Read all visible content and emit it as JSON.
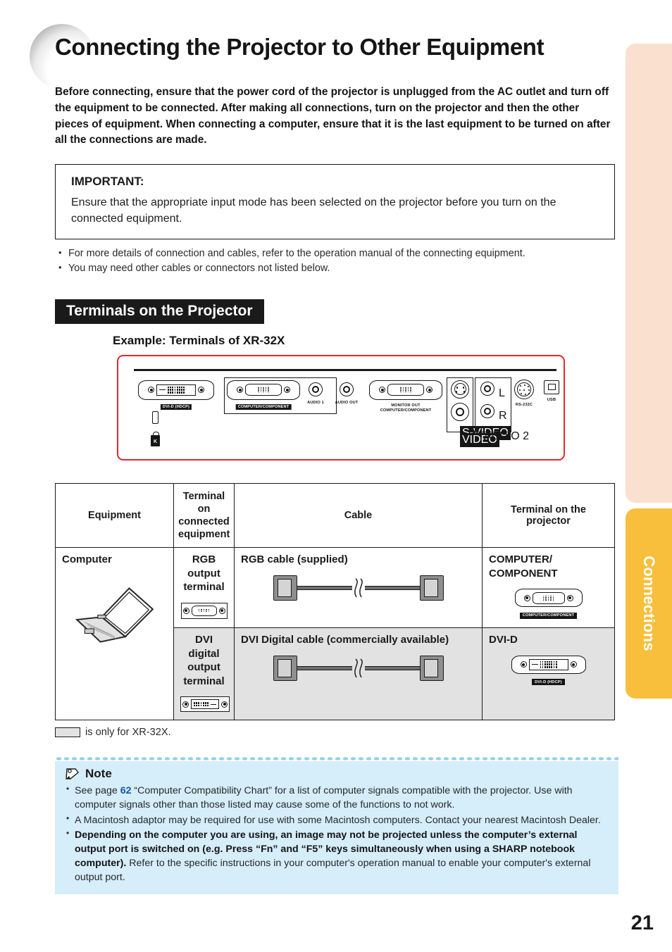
{
  "page": {
    "title": "Connecting the Projector to Other Equipment",
    "number": "21",
    "side_tab_label": "Connections",
    "accent_amber": "#f7bf3c",
    "accent_peach": "#fae0ce",
    "accent_red": "#e8262a",
    "note_blue": "#d6edfa"
  },
  "intro": "Before connecting, ensure that the power cord of the projector is unplugged from the AC outlet and turn off the equipment to be connected. After making all connections, turn on the projector and then the other pieces of equipment. When connecting a computer, ensure that it is the last equipment to be turned on after all the connections are made.",
  "important": {
    "title": "IMPORTANT:",
    "body": "Ensure that the appropriate input mode has been selected on the projector before you turn on the connected equipment."
  },
  "bullets": [
    "For more details of connection and cables, refer to the operation manual of the connecting equipment.",
    "You may need other cables or connectors not listed below."
  ],
  "section": {
    "heading": "Terminals on the Projector",
    "example_title": "Example: Terminals of XR-32X"
  },
  "terminal_panel": {
    "ports": [
      {
        "label": "DVI-D (HDCP)",
        "style": "inverted"
      },
      {
        "label": "COMPUTER/COMPONENT",
        "style": "inverted"
      },
      {
        "label": "AUDIO 1",
        "style": "plain"
      },
      {
        "label": "AUDIO OUT",
        "style": "plain"
      },
      {
        "label": "MONITOR OUT",
        "style": "plain"
      },
      {
        "label": "COMPUTER/COMPONENT",
        "style": "plain"
      },
      {
        "label": "S-VIDEO",
        "style": "inverted"
      },
      {
        "label": "VIDEO",
        "style": "inverted"
      },
      {
        "label": "AUDIO 2",
        "style": "plain"
      },
      {
        "label": "L",
        "style": "plain"
      },
      {
        "label": "R",
        "style": "plain"
      },
      {
        "label": "RS-232C",
        "style": "plain"
      },
      {
        "label": "USB",
        "style": "plain"
      }
    ]
  },
  "table": {
    "headers": {
      "equipment": "Equipment",
      "terminal_connected": "Terminal on\nconnected equipment",
      "cable": "Cable",
      "terminal_projector": "Terminal on the\nprojector"
    },
    "rows": [
      {
        "equipment": "Computer",
        "terminal_connected": "RGB\noutput\nterminal",
        "cable": "RGB cable (supplied)",
        "terminal_projector": "COMPUTER/\nCOMPONENT",
        "projector_port_tag": "COMPUTER/COMPONENT",
        "shaded": false
      },
      {
        "equipment": "",
        "terminal_connected": "DVI digital\noutput\nterminal",
        "cable": "DVI Digital cable (commercially available)",
        "terminal_projector": "DVI-D",
        "projector_port_tag": "DVI-D (HDCP)",
        "shaded": true
      }
    ],
    "legend": "is only for XR-32X."
  },
  "note": {
    "title": "Note",
    "items": [
      {
        "pre": "See page ",
        "ref": "62",
        "post": " “Computer Compatibility Chart” for a list of computer signals compatible with the projector. Use with computer signals other than those listed may cause some of the functions to not work."
      },
      {
        "pre": "A Macintosh adaptor may be required for use with some Macintosh computers. Contact your nearest Macintosh Dealer.",
        "ref": "",
        "post": ""
      },
      {
        "bold": "Depending on the computer you are using, an image may not be projected unless the computer’s external output port is switched on (e.g. Press “Fn” and “F5” keys simultaneously when using a SHARP notebook computer).",
        "rest": " Refer to the specific instructions in your computer's operation manual to enable your computer's external output port."
      }
    ]
  }
}
